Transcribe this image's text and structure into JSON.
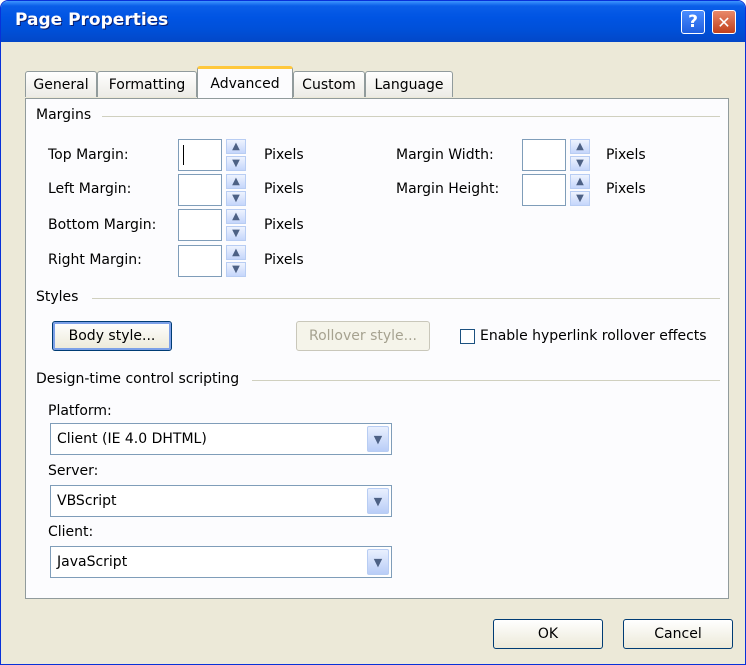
{
  "window": {
    "title": "Page Properties",
    "help_label": "?",
    "close_label": "✕"
  },
  "tabs": [
    {
      "label": "General"
    },
    {
      "label": "Formatting"
    },
    {
      "label": "Advanced"
    },
    {
      "label": "Custom"
    },
    {
      "label": "Language"
    }
  ],
  "active_tab": "Advanced",
  "margins": {
    "group_label": "Margins",
    "top": {
      "label": "Top Margin:",
      "value": "",
      "unit": "Pixels"
    },
    "left": {
      "label": "Left Margin:",
      "value": "",
      "unit": "Pixels"
    },
    "bottom": {
      "label": "Bottom Margin:",
      "value": "",
      "unit": "Pixels"
    },
    "right": {
      "label": "Right Margin:",
      "value": "",
      "unit": "Pixels"
    },
    "width": {
      "label": "Margin Width:",
      "value": "",
      "unit": "Pixels"
    },
    "height": {
      "label": "Margin Height:",
      "value": "",
      "unit": "Pixels"
    }
  },
  "styles": {
    "group_label": "Styles",
    "body_style": "Body style...",
    "rollover_style": "Rollover style...",
    "rollover_checkbox": "Enable hyperlink rollover effects",
    "rollover_checked": false
  },
  "scripting": {
    "group_label": "Design-time control scripting",
    "platform_label": "Platform:",
    "platform_value": "Client (IE 4.0 DHTML)",
    "server_label": "Server:",
    "server_value": "VBScript",
    "client_label": "Client:",
    "client_value": "JavaScript"
  },
  "buttons": {
    "ok": "OK",
    "cancel": "Cancel"
  },
  "icons": {
    "spin_up": "spin-up-icon",
    "spin_down": "spin-down-icon",
    "dropdown": "chevron-down-icon"
  }
}
